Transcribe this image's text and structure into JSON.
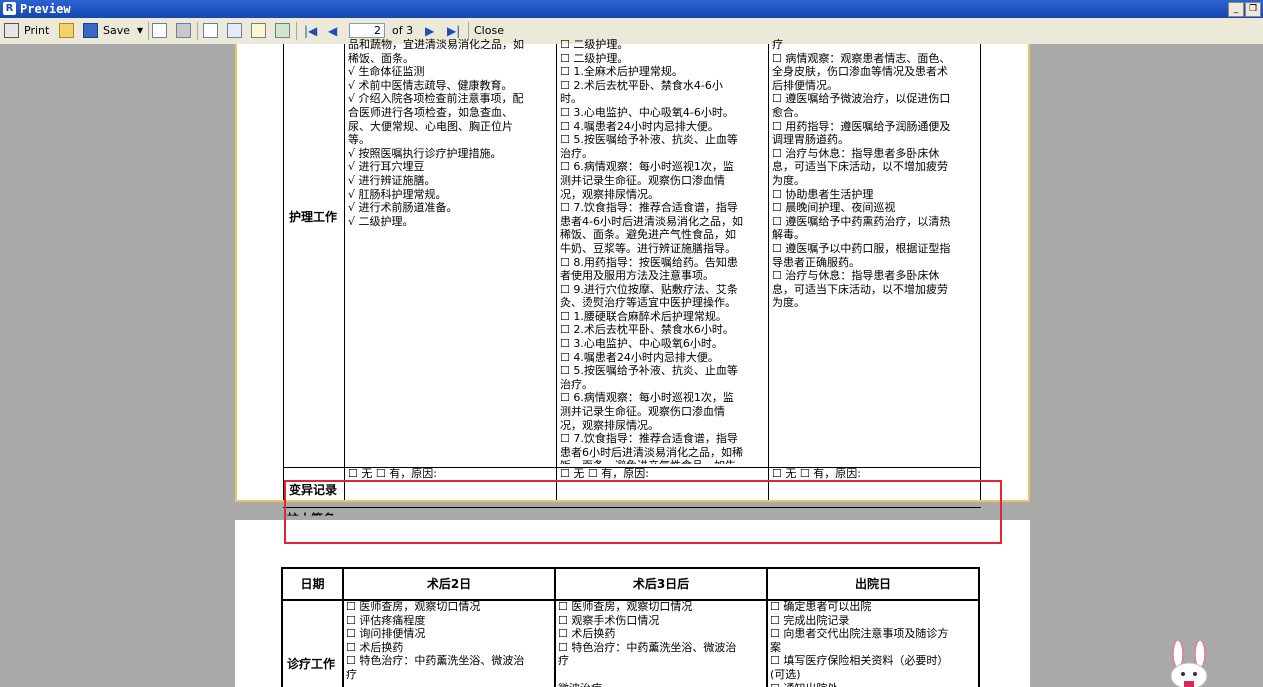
{
  "window": {
    "title": "Preview",
    "app_icon_letter": "R",
    "min_label": "_",
    "restore_label": "❐"
  },
  "toolbar": {
    "print_label": "Print",
    "save_label": "Save",
    "page_current": "2",
    "page_of": "of 3",
    "close_label": "Close"
  },
  "page1": {
    "row_label_nursing": "护理工作",
    "row_label_variation": "变异记录",
    "row_label_signature": "护士签名",
    "col1_text": "品和蔬物，宜进清淡易消化之品，如\n稀饭、面条。\n√ 生命体征监测\n√ 术前中医情志疏导、健康教育。\n√ 介绍入院各项检查前注意事项，配\n合医师进行各项检查，如急查血、\n尿、大便常规、心电图、胸正位片\n等。\n√ 按照医嘱执行诊疗护理措施。\n√ 进行耳穴埋豆\n√ 进行辨证施膳。\n√ 肛肠科护理常规。\n√ 进行术前肠道准备。\n√ 二级护理。",
    "col2_text": "☐ 二级护理。\n☐ 二级护理。\n☐ 1.全麻术后护理常规。\n☐ 2.术后去枕平卧、禁食水4-6小\n时。\n☐ 3.心电监护、中心吸氧4-6小时。\n☐ 4.嘱患者24小时内忌排大便。\n☐ 5.按医嘱给予补液、抗炎、止血等\n治疗。\n☐ 6.病情观察：每小时巡视1次，监\n测并记录生命征。观察伤口渗血情\n况，观察排尿情况。\n☐ 7.饮食指导：推荐合适食谱，指导\n患者4-6小时后进清淡易消化之品，如\n稀饭、面条。避免进产气性食品，如\n牛奶、豆浆等。进行辨证施膳指导。\n☐ 8.用药指导：按医嘱给药。告知患\n者使用及服用方法及注意事项。\n☐ 9.进行穴位按摩、贴敷疗法、艾条\n灸、烫熨治疗等适宜中医护理操作。\n☐ 1.腰硬联合麻醉术后护理常规。\n☐ 2.术后去枕平卧、禁食水6小时。\n☐ 3.心电监护、中心吸氧6小时。\n☐ 4.嘱患者24小时内忌排大便。\n☐ 5.按医嘱给予补液、抗炎、止血等\n治疗。\n☐ 6.病情观察：每小时巡视1次，监\n测并记录生命征。观察伤口渗血情\n况，观察排尿情况。\n☐ 7.饮食指导：推荐合适食谱，指导\n患者6小时后进清淡易消化之品，如稀\n饭、面条。避免进产气性食品，如牛",
    "col3_text": "疗\n☐ 病情观察：观察患者情志、面色、\n全身皮肤，伤口渗血等情况及患者术\n后排便情况。\n☐ 遵医嘱给予微波治疗，以促进伤口\n愈合。\n☐ 用药指导：遵医嘱给予润肠通便及\n调理胃肠道药。\n☐ 治疗与休息：指导患者多卧床休\n息，可适当下床活动，以不增加疲劳\n为度。\n☐ 协助患者生活护理\n☐ 晨晚间护理、夜间巡视\n☐ 遵医嘱给予中药熏药治疗，以清热\n解毒。\n☐ 遵医嘱予以中药口服，根据证型指\n导患者正确服药。\n☐ 治疗与休息：指导患者多卧床休\n息，可适当下床活动，以不增加疲劳\n为度。",
    "variation_col1": "☐ 无 ☐ 有，原因:",
    "variation_col2": "☐ 无 ☐ 有，原因:",
    "variation_col3": "☐ 无 ☐ 有，原因:"
  },
  "page2": {
    "header_date": "日期",
    "header_col1": "术后2日",
    "header_col2": "术后3日后",
    "header_col3": "出院日",
    "row_label_treatment": "诊疗工作",
    "col1_text": "☐ 医师查房，观察切口情况\n☐ 评估疼痛程度\n☐ 询问排便情况\n☐ 术后换药\n☐ 特色治疗：中药薰洗坐浴、微波治\n疗",
    "col2_text": "☐ 医师查房，观察切口情况\n☐ 观察手术伤口情况\n☐ 术后换药\n☐ 特色治疗：中药薰洗坐浴、微波治\n疗\n\n微波治疗",
    "col3_text": "☐ 确定患者可以出院\n☐ 完成出院记录\n☐ 向患者交代出院注意事项及随诊方\n案\n☐ 填写医疗保险相关资料（必要时）\n(可选)\n☐ 通知出院处"
  }
}
